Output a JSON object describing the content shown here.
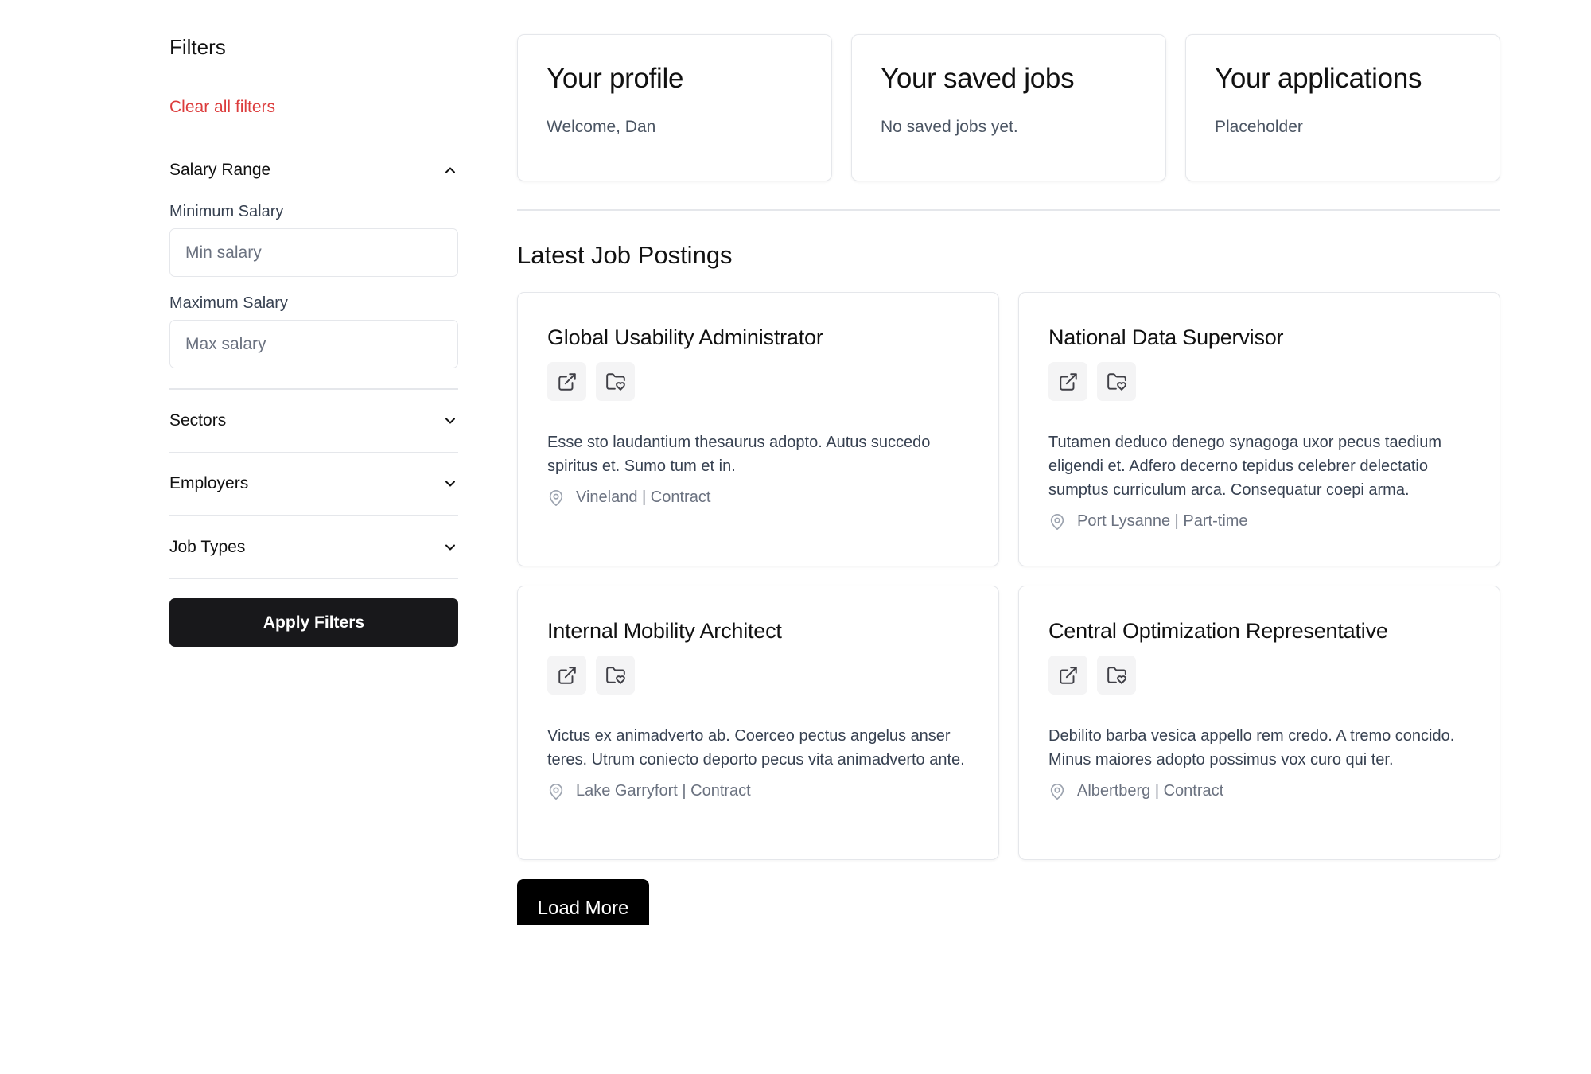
{
  "sidebar": {
    "title": "Filters",
    "clear_all": "Clear all filters",
    "salary": {
      "heading": "Salary Range",
      "min_label": "Minimum Salary",
      "min_placeholder": "Min salary",
      "max_label": "Maximum Salary",
      "max_placeholder": "Max salary"
    },
    "sections": [
      "Sectors",
      "Employers",
      "Job Types"
    ],
    "apply_label": "Apply Filters"
  },
  "top_cards": [
    {
      "title": "Your profile",
      "text": "Welcome, Dan"
    },
    {
      "title": "Your saved jobs",
      "text": "No saved jobs yet."
    },
    {
      "title": "Your applications",
      "text": "Placeholder"
    }
  ],
  "latest_title": "Latest Job Postings",
  "jobs": [
    {
      "title": "Global Usability Administrator",
      "description": "Esse sto laudantium thesaurus adopto. Autus succedo spiritus et. Sumo tum et in.",
      "location": "Vineland | Contract"
    },
    {
      "title": "National Data Supervisor",
      "description": "Tutamen deduco denego synagoga uxor pecus taedium eligendi et. Adfero decerno tepidus celebrer delectatio sumptus curriculum arca. Consequatur coepi arma.",
      "location": "Port Lysanne | Part-time"
    },
    {
      "title": "Internal Mobility Architect",
      "description": "Victus ex animadverto ab. Coerceo pectus angelus anser teres. Utrum coniecto deporto pecus vita animadverto ante.",
      "location": "Lake Garryfort | Contract"
    },
    {
      "title": "Central Optimization Representative",
      "description": "Debilito barba vesica appello rem credo. A tremo concido. Minus maiores adopto possimus vox curo qui ter.",
      "location": "Albertberg | Contract"
    }
  ],
  "load_more": "Load More",
  "icons": {
    "open": "external-link-icon",
    "save": "folder-heart-icon",
    "location": "map-pin-icon",
    "expand": "chevron-down-icon",
    "collapse": "chevron-up-icon"
  },
  "colors": {
    "accent_danger": "#dc3c3c",
    "button_dark": "#18181b",
    "border": "#e5e7eb"
  }
}
